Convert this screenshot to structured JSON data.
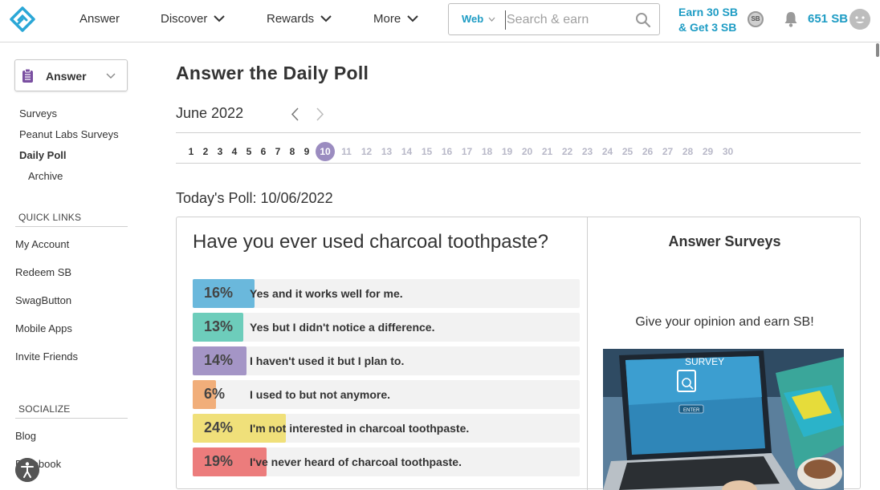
{
  "header": {
    "nav": [
      {
        "label": "Answer"
      },
      {
        "label": "Discover"
      },
      {
        "label": "Rewards"
      },
      {
        "label": "More"
      }
    ],
    "search": {
      "scope": "Web",
      "placeholder": "Search & earn"
    },
    "earn_link": {
      "line1": "Earn 30 SB",
      "line2": "& Get 3 SB"
    },
    "coin_label": "SB",
    "balance": "651 SB"
  },
  "sidebar": {
    "selector": "Answer",
    "links": [
      {
        "label": "Surveys",
        "active": false
      },
      {
        "label": "Peanut Labs Surveys",
        "active": false
      },
      {
        "label": "Daily Poll",
        "active": true
      },
      {
        "label": "Archive",
        "active": false
      }
    ],
    "quick_links": {
      "heading": "QUICK LINKS",
      "items": [
        {
          "label": "My Account"
        },
        {
          "label": "Redeem SB"
        },
        {
          "label": "SwagButton"
        },
        {
          "label": "Mobile Apps"
        },
        {
          "label": "Invite Friends"
        }
      ]
    },
    "socialize": {
      "heading": "SOCIALIZE",
      "items": [
        {
          "label": "Blog"
        },
        {
          "label": "Facebook"
        }
      ]
    }
  },
  "main": {
    "title": "Answer the Daily Poll",
    "month": "June 2022",
    "days": [
      "1",
      "2",
      "3",
      "4",
      "5",
      "6",
      "7",
      "8",
      "9",
      "10",
      "11",
      "12",
      "13",
      "14",
      "15",
      "16",
      "17",
      "18",
      "19",
      "20",
      "21",
      "22",
      "23",
      "24",
      "25",
      "26",
      "27",
      "28",
      "29",
      "30"
    ],
    "current_day": "10",
    "poll_date": "Today's Poll: 10/06/2022",
    "question": "Have you ever used charcoal toothpaste?",
    "results": [
      {
        "pct": "16%",
        "value": 16,
        "answer": "Yes and it works well for me.",
        "color": "#6ab8dc"
      },
      {
        "pct": "13%",
        "value": 13,
        "answer": "Yes but I didn't notice a difference.",
        "color": "#6dcdbb"
      },
      {
        "pct": "14%",
        "value": 14,
        "answer": "I haven't used it but I plan to.",
        "color": "#a495c6"
      },
      {
        "pct": "6%",
        "value": 6,
        "answer": "I used to but not anymore.",
        "color": "#f1ae7a"
      },
      {
        "pct": "24%",
        "value": 24,
        "answer": "I'm not interested in charcoal toothpaste.",
        "color": "#f0e07a"
      },
      {
        "pct": "19%",
        "value": 19,
        "answer": "I've never heard of charcoal toothpaste.",
        "color": "#ec7c7c"
      }
    ],
    "promo": {
      "title": "Answer Surveys",
      "text": "Give your opinion and earn SB!",
      "screen_text": "SURVEY",
      "button_text": "ENTER"
    }
  },
  "colors": {
    "accent": "#1e9cc4",
    "current_day": "#9b8cc0"
  }
}
